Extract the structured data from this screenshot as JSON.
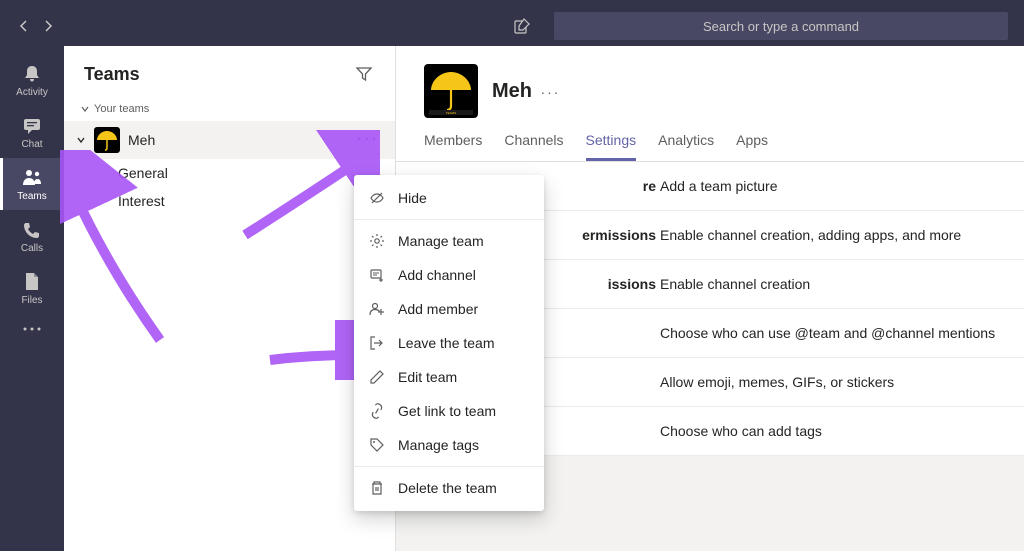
{
  "search": {
    "placeholder": "Search or type a command"
  },
  "rail": {
    "items": [
      {
        "label": "Activity"
      },
      {
        "label": "Chat"
      },
      {
        "label": "Teams"
      },
      {
        "label": "Calls"
      },
      {
        "label": "Files"
      }
    ]
  },
  "teamsPanel": {
    "title": "Teams",
    "section_label": "Your teams",
    "team": {
      "name": "Meh"
    },
    "channels": [
      {
        "name": "General"
      },
      {
        "name": "Interest"
      }
    ]
  },
  "content": {
    "title": "Meh",
    "tabs": [
      {
        "label": "Members"
      },
      {
        "label": "Channels"
      },
      {
        "label": "Settings"
      },
      {
        "label": "Analytics"
      },
      {
        "label": "Apps"
      }
    ],
    "settings": [
      {
        "label_suffix": "re",
        "desc": "Add a team picture"
      },
      {
        "label_suffix": "ermissions",
        "desc": "Enable channel creation, adding apps, and more"
      },
      {
        "label_suffix": "issions",
        "desc": "Enable channel creation"
      },
      {
        "label_suffix": "",
        "desc": "Choose who can use @team and @channel mentions"
      },
      {
        "label_suffix": "",
        "desc": "Allow emoji, memes, GIFs, or stickers"
      },
      {
        "label_suffix": "",
        "desc": "Choose who can add tags"
      }
    ]
  },
  "contextMenu": {
    "items": [
      {
        "label": "Hide"
      },
      {
        "label": "Manage team"
      },
      {
        "label": "Add channel"
      },
      {
        "label": "Add member"
      },
      {
        "label": "Leave the team"
      },
      {
        "label": "Edit team"
      },
      {
        "label": "Get link to team"
      },
      {
        "label": "Manage tags"
      },
      {
        "label": "Delete the team"
      }
    ]
  },
  "colors": {
    "accent": "#6264a7",
    "annotation": "#a855f7"
  }
}
